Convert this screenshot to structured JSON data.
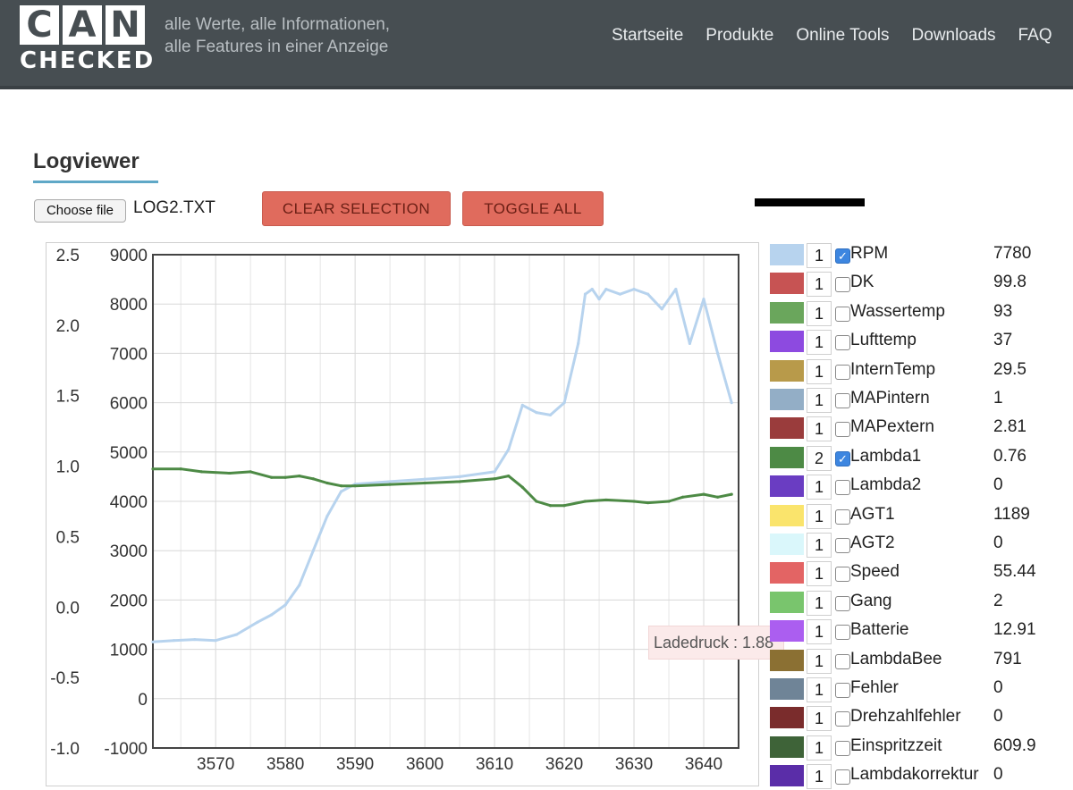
{
  "header": {
    "logo_letters": [
      "C",
      "A",
      "N"
    ],
    "logo_word": "CHECKED",
    "tagline_line1": "alle Werte, alle Informationen,",
    "tagline_line2": "alle Features in einer Anzeige",
    "nav": [
      "Startseite",
      "Produkte",
      "Online Tools",
      "Downloads",
      "FAQ"
    ]
  },
  "page": {
    "title": "Logviewer",
    "choose_file_label": "Choose file",
    "file_name": "LOG2.TXT",
    "clear_selection_label": "CLEAR SELECTION",
    "toggle_all_label": "TOGGLE ALL"
  },
  "tooltip": {
    "text": "Ladedruck : 1.88"
  },
  "chart_data": {
    "type": "line",
    "x_ticks": [
      "3570",
      "3580",
      "3590",
      "3600",
      "3610",
      "3620",
      "3630",
      "3640"
    ],
    "x_range": [
      3561,
      3645
    ],
    "left_axis_ticks": [
      "2.5",
      "2.0",
      "1.5",
      "1.0",
      "0.5",
      "0.0",
      "-0.5",
      "-1.0"
    ],
    "left_range": [
      -1.0,
      2.5
    ],
    "right_axis_ticks": [
      "9000",
      "8000",
      "7000",
      "6000",
      "5000",
      "4000",
      "3000",
      "2000",
      "1000",
      "0",
      "-1000"
    ],
    "right_range": [
      -1000,
      9000
    ],
    "grid": true,
    "series": [
      {
        "name": "RPM",
        "color": "#b7d3ee",
        "axis": "right",
        "x": [
          3561,
          3564,
          3567,
          3570,
          3573,
          3576,
          3578,
          3580,
          3582,
          3584,
          3586,
          3588,
          3590,
          3595,
          3600,
          3605,
          3610,
          3612,
          3614,
          3616,
          3618,
          3620,
          3622,
          3623,
          3624,
          3625,
          3626,
          3628,
          3630,
          3632,
          3634,
          3636,
          3638,
          3640,
          3642,
          3644
        ],
        "values": [
          1150,
          1180,
          1200,
          1180,
          1300,
          1550,
          1700,
          1900,
          2300,
          3000,
          3700,
          4200,
          4350,
          4400,
          4450,
          4500,
          4600,
          5050,
          5950,
          5800,
          5750,
          6000,
          7200,
          8200,
          8300,
          8100,
          8300,
          8200,
          8300,
          8200,
          7900,
          8300,
          7200,
          8100,
          7000,
          6000
        ]
      },
      {
        "name": "Lambda1",
        "color": "#4d8a45",
        "axis": "left",
        "x": [
          3561,
          3565,
          3568,
          3572,
          3575,
          3578,
          3580,
          3582,
          3584,
          3586,
          3588,
          3590,
          3595,
          3600,
          3605,
          3610,
          3612,
          3614,
          3616,
          3618,
          3620,
          3623,
          3626,
          3630,
          3632,
          3635,
          3637,
          3640,
          3642,
          3644
        ],
        "values": [
          0.98,
          0.98,
          0.96,
          0.95,
          0.96,
          0.92,
          0.92,
          0.93,
          0.91,
          0.88,
          0.86,
          0.86,
          0.87,
          0.88,
          0.89,
          0.91,
          0.93,
          0.85,
          0.75,
          0.72,
          0.72,
          0.75,
          0.76,
          0.75,
          0.74,
          0.75,
          0.78,
          0.8,
          0.78,
          0.8
        ]
      }
    ]
  },
  "legend": [
    {
      "color": "#b7d3ee",
      "axis": "1",
      "checked": true,
      "name": "RPM",
      "value": "7780"
    },
    {
      "color": "#c75353",
      "axis": "1",
      "checked": false,
      "name": "DK",
      "value": "99.8"
    },
    {
      "color": "#6aa65c",
      "axis": "1",
      "checked": false,
      "name": "Wassertemp",
      "value": "93"
    },
    {
      "color": "#8d4ae0",
      "axis": "1",
      "checked": false,
      "name": "Lufttemp",
      "value": "37"
    },
    {
      "color": "#b89a4a",
      "axis": "1",
      "checked": false,
      "name": "InternTemp",
      "value": "29.5"
    },
    {
      "color": "#93aec6",
      "axis": "1",
      "checked": false,
      "name": "MAPintern",
      "value": "1"
    },
    {
      "color": "#9a3c3c",
      "axis": "1",
      "checked": false,
      "name": "MAPextern",
      "value": "2.81"
    },
    {
      "color": "#4d8a45",
      "axis": "2",
      "checked": true,
      "name": "Lambda1",
      "value": "0.76"
    },
    {
      "color": "#6a3dc2",
      "axis": "1",
      "checked": false,
      "name": "Lambda2",
      "value": "0"
    },
    {
      "color": "#fae46c",
      "axis": "1",
      "checked": false,
      "name": "AGT1",
      "value": "1189"
    },
    {
      "color": "#daf7fb",
      "axis": "1",
      "checked": false,
      "name": "AGT2",
      "value": "0"
    },
    {
      "color": "#e36464",
      "axis": "1",
      "checked": false,
      "name": "Speed",
      "value": "55.44"
    },
    {
      "color": "#79c56d",
      "axis": "1",
      "checked": false,
      "name": "Gang",
      "value": "2"
    },
    {
      "color": "#ab5ef0",
      "axis": "1",
      "checked": false,
      "name": "Batterie",
      "value": "12.91"
    },
    {
      "color": "#8b7033",
      "axis": "1",
      "checked": false,
      "name": "LambdaBee",
      "value": "791"
    },
    {
      "color": "#6f8497",
      "axis": "1",
      "checked": false,
      "name": "Fehler",
      "value": "0"
    },
    {
      "color": "#7a2c2c",
      "axis": "1",
      "checked": false,
      "name": "Drehzahlfehler",
      "value": "0"
    },
    {
      "color": "#3e6338",
      "axis": "1",
      "checked": false,
      "name": "Einspritzzeit",
      "value": "609.9"
    },
    {
      "color": "#5a2da8",
      "axis": "1",
      "checked": false,
      "name": "Lambdakorrektur",
      "value": "0"
    }
  ]
}
